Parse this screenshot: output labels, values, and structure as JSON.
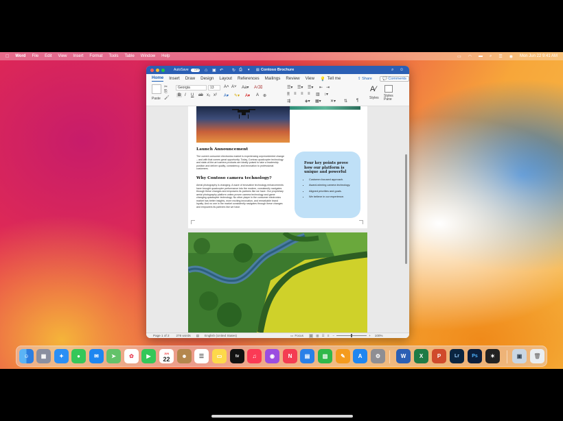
{
  "menubar": {
    "app": "Word",
    "items": [
      "File",
      "Edit",
      "View",
      "Insert",
      "Format",
      "Tools",
      "Table",
      "Window",
      "Help"
    ],
    "clock": "Mon Jun 22  9:41 AM"
  },
  "window": {
    "autosave_label": "AutoSave",
    "autosave_state": "OFF",
    "doc_title": "Contoso Brochure",
    "tabs": [
      "Home",
      "Insert",
      "Draw",
      "Design",
      "Layout",
      "References",
      "Mailings",
      "Review",
      "View",
      "Tell me"
    ],
    "share_label": "Share",
    "comments_label": "Comments",
    "ribbon": {
      "paste_label": "Paste",
      "font_name": "Georgia",
      "font_size": "13",
      "styles_label": "Styles",
      "styles_pane_label": "Styles\nPane"
    }
  },
  "document": {
    "launch_heading": "Launch Announcement",
    "launch_body": "The current consumer electronics market is experiencing unprecedented change – and with that comes great opportunity. Today, Contoso quadcopter technology and state-of-the-art camera products are ideally poised to take a leadership position and deliver quality, consistency, and innovation to professional customers.",
    "why_heading": "Why Contoso camera technology?",
    "why_body": "Aerial photography is changing. A wave of innovative technology enhancements have brought quadcopter performance into the modern, consistently navigates through these changes and empowers its partners like we have. Our proprietary aerial photography platform unites proven camera technology and game changing quadcopter technology. No other player in the consumer electronics market has better insights, more exciting innovation, and remarkable brand loyalty. And no one in the market consistently navigates through these changes and empowers its partners like we have.",
    "callout_heading": "Four key points prove how our platform is unique and powerful",
    "callout_points": [
      "Customer-focused approach.",
      "Award-winning camera technology.",
      "Aligned priorities and goals.",
      "We believe in our experience."
    ]
  },
  "status": {
    "page": "Page 1 of 2",
    "words": "276 words",
    "language": "English (United States)",
    "focus": "Focus",
    "zoom": "100%"
  },
  "dock": {
    "apps": [
      "finder-icon",
      "launchpad-icon",
      "safari-icon",
      "messages-icon",
      "mail-icon",
      "maps-icon",
      "photos-icon",
      "facetime-icon",
      "calendar-icon",
      "contacts-icon",
      "reminders-icon",
      "notes-icon",
      "tv-icon",
      "music-icon",
      "podcasts-icon",
      "news-icon",
      "keynote-icon",
      "numbers-icon",
      "pages-icon",
      "app-store-icon",
      "system-preferences-icon",
      "word-icon",
      "excel-icon",
      "powerpoint-icon",
      "lightroom-icon",
      "photoshop-icon",
      "final-cut-icon",
      "preview-icon",
      "trash-icon"
    ],
    "calendar_month": "JUN",
    "calendar_day": "22"
  }
}
